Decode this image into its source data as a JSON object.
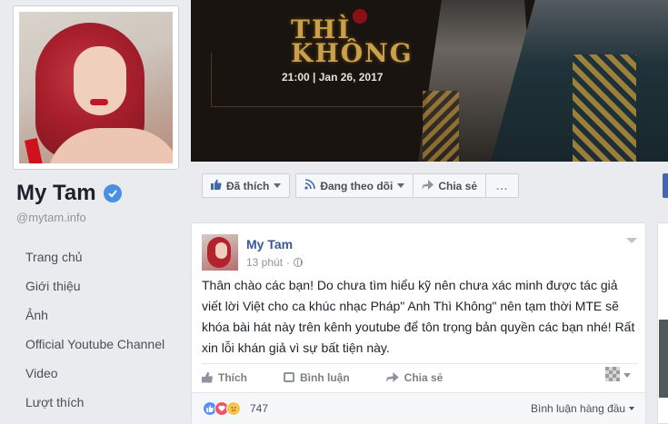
{
  "profile": {
    "name": "My Tam",
    "handle": "@mytam.info"
  },
  "sidebar": {
    "items": [
      {
        "label": "Trang chủ"
      },
      {
        "label": "Giới thiệu"
      },
      {
        "label": "Ảnh"
      },
      {
        "label": "Official Youtube Channel"
      },
      {
        "label": "Video"
      },
      {
        "label": "Lượt thích"
      }
    ]
  },
  "cover": {
    "title": "THÌ\nKHÔNG",
    "datetime": "21:00 | Jan 26, 2017"
  },
  "actions": {
    "liked": "Đã thích",
    "following": "Đang theo dõi",
    "share": "Chia sẻ",
    "more": "..."
  },
  "post": {
    "author": "My Tam",
    "time": "13 phút",
    "text": "Thân chào các bạn! Do chưa tìm hiểu kỹ nên chưa xác minh được tác giả viết lời Việt cho ca khúc nhạc Pháp\" Anh Thì Không\" nên tạm thời MTE sẽ khóa bài hát này trên kênh youtube để tôn trọng bản quyền các bạn nhé! Rất xin lỗi khán giả vì sự bất tiện này.",
    "like_label": "Thích",
    "comment_label": "Bình luận",
    "share_label": "Chia sẻ",
    "reaction_count": "747",
    "top_comments_label": "Bình luận hàng đầu"
  },
  "colors": {
    "link": "#365899",
    "verified": "#4a90e2",
    "background": "#e9ebee"
  }
}
